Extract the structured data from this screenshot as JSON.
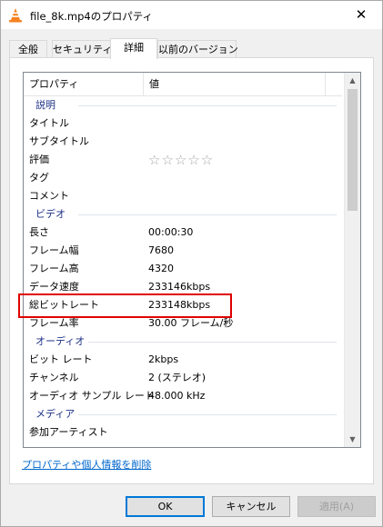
{
  "window": {
    "title": "file_8k.mp4のプロパティ"
  },
  "tabs": [
    {
      "label": "全般",
      "active": false
    },
    {
      "label": "セキュリティ",
      "active": false
    },
    {
      "label": "詳細",
      "active": true
    },
    {
      "label": "以前のバージョン",
      "active": false
    }
  ],
  "list": {
    "columns": [
      "プロパティ",
      "値"
    ],
    "groups": {
      "description": "説明",
      "video": "ビデオ",
      "audio": "オーディオ",
      "media": "メディア"
    },
    "description_rows": [
      {
        "name": "タイトル",
        "value": ""
      },
      {
        "name": "サブタイトル",
        "value": ""
      },
      {
        "name": "評価",
        "value": ""
      },
      {
        "name": "タグ",
        "value": ""
      },
      {
        "name": "コメント",
        "value": ""
      }
    ],
    "rating": {
      "stars_text": "☆☆☆☆☆",
      "max": 5,
      "value": 0
    },
    "video_rows": [
      {
        "name": "長さ",
        "value": "00:00:30"
      },
      {
        "name": "フレーム幅",
        "value": "7680"
      },
      {
        "name": "フレーム高",
        "value": "4320"
      },
      {
        "name": "データ速度",
        "value": "233146kbps"
      },
      {
        "name": "総ビットレート",
        "value": "233148kbps"
      },
      {
        "name": "フレーム率",
        "value": "30.00 フレーム/秒"
      }
    ],
    "audio_rows": [
      {
        "name": "ビット レート",
        "value": "2kbps"
      },
      {
        "name": "チャンネル",
        "value": "2 (ステレオ)"
      },
      {
        "name": "オーディオ サンプル レート",
        "value": "48.000 kHz"
      }
    ],
    "media_rows": [
      {
        "name": "参加アーティスト",
        "value": ""
      }
    ]
  },
  "links": {
    "remove_properties": "プロパティや個人情報を削除"
  },
  "buttons": {
    "ok": "OK",
    "cancel": "キャンセル",
    "apply": "適用(A)"
  },
  "colors": {
    "highlight": "#e00000",
    "link": "#0066cc",
    "group_heading": "#1e3287"
  },
  "icons": {
    "app": "vlc-cone-icon",
    "close": "close-icon"
  }
}
